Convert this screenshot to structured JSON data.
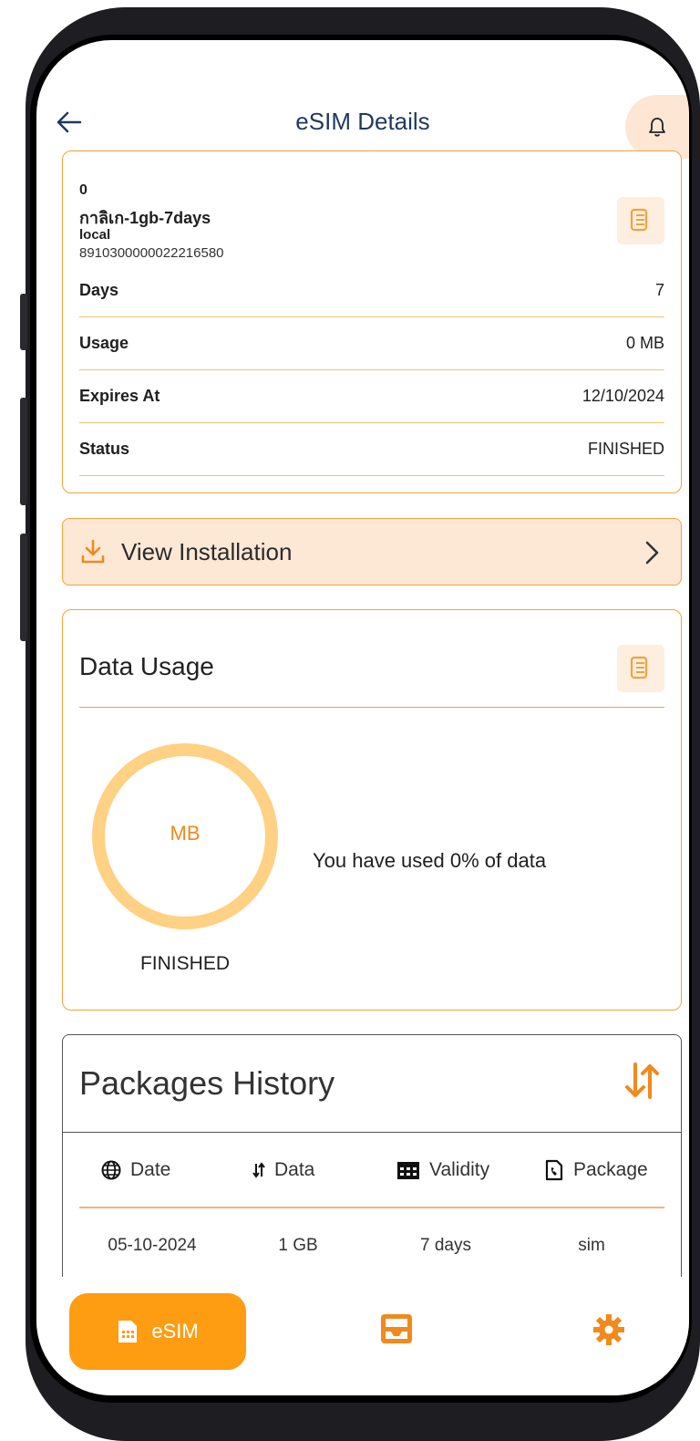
{
  "header": {
    "title": "eSIM Details"
  },
  "esim": {
    "id_line": "0",
    "plan_name": "กาลิเก-1gb-7days",
    "type": "local",
    "iccid": "8910300000022216580",
    "rows": [
      {
        "label": "Days",
        "value": "7"
      },
      {
        "label": "Usage",
        "value": "0 MB"
      },
      {
        "label": "Expires At",
        "value": "12/10/2024"
      },
      {
        "label": "Status",
        "value": "FINISHED"
      }
    ]
  },
  "install": {
    "label": "View Installation"
  },
  "usage": {
    "title": "Data Usage",
    "ring_unit": "MB",
    "status": "FINISHED",
    "message": "You have used 0% of data",
    "percent_used": 0
  },
  "history": {
    "title": "Packages History",
    "columns": [
      "Date",
      "Data",
      "Validity",
      "Package"
    ],
    "rows": [
      {
        "date": "05-10-2024",
        "data": "1 GB",
        "validity": "7 days",
        "package": "sim"
      }
    ]
  },
  "nav": {
    "esim_label": "eSIM"
  },
  "colors": {
    "accent": "#fe9c12",
    "accent_soft": "#fde8d6",
    "border": "#f2a23a",
    "title": "#1f3a5f"
  },
  "icons": [
    "back-arrow-icon",
    "bell-icon",
    "copy-icon",
    "download-icon",
    "chevron-right-icon",
    "sort-icon",
    "globe-icon",
    "calendar-icon",
    "phone-icon",
    "sim-card-icon",
    "inbox-icon",
    "gear-icon"
  ]
}
